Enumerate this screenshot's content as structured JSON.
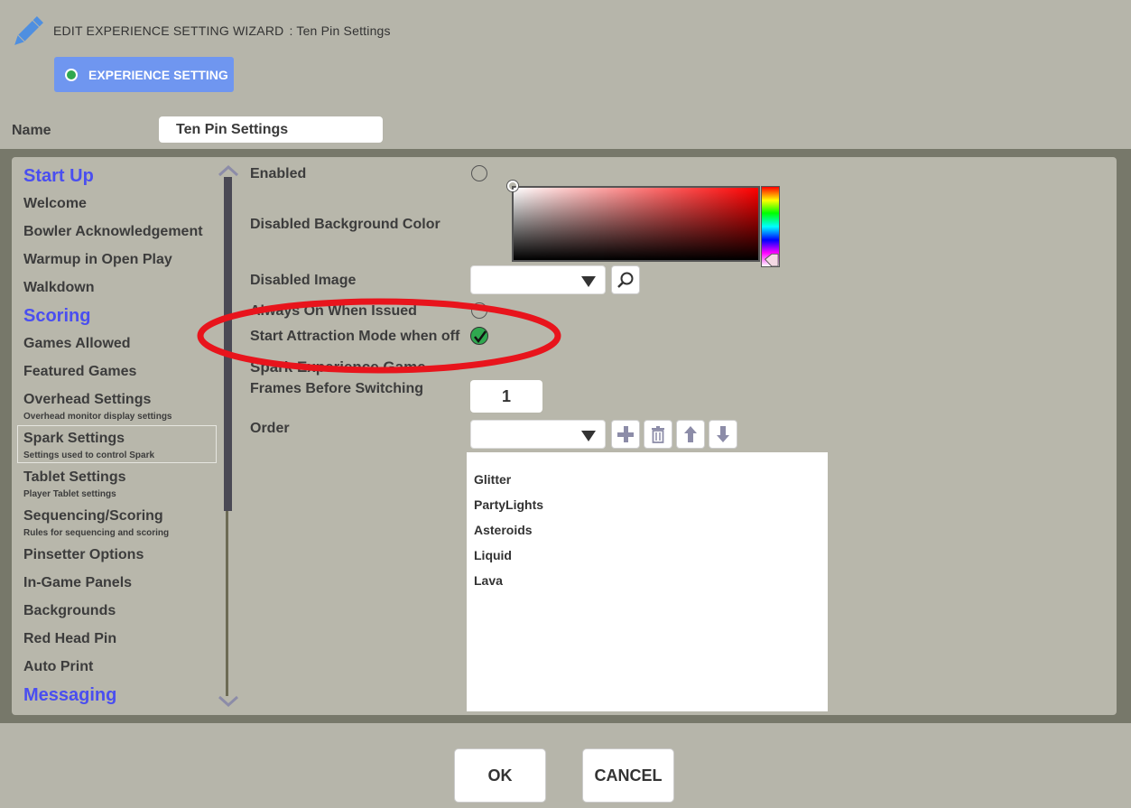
{
  "header": {
    "title": "EDIT EXPERIENCE SETTING WIZARD",
    "subtitle": ": Ten Pin Settings"
  },
  "tabs": [
    {
      "label": "EXPERIENCE SETTING"
    }
  ],
  "name": {
    "label": "Name",
    "value": "Ten Pin Settings"
  },
  "sidebar": {
    "items": [
      {
        "type": "head",
        "label": "Start Up"
      },
      {
        "type": "item",
        "label": "Welcome"
      },
      {
        "type": "item",
        "label": "Bowler Acknowledgement"
      },
      {
        "type": "item",
        "label": "Warmup in Open Play"
      },
      {
        "type": "item",
        "label": "Walkdown"
      },
      {
        "type": "head",
        "label": "Scoring"
      },
      {
        "type": "item",
        "label": "Games Allowed"
      },
      {
        "type": "item",
        "label": "Featured Games"
      },
      {
        "type": "item",
        "label": "Overhead Settings",
        "sub": "Overhead monitor display settings"
      },
      {
        "type": "item",
        "label": "Spark Settings",
        "sub": "Settings used to control Spark",
        "selected": true
      },
      {
        "type": "item",
        "label": "Tablet Settings",
        "sub": "Player Tablet settings"
      },
      {
        "type": "item",
        "label": "Sequencing/Scoring",
        "sub": "Rules for sequencing and scoring"
      },
      {
        "type": "item",
        "label": "Pinsetter Options"
      },
      {
        "type": "item",
        "label": "In-Game Panels"
      },
      {
        "type": "item",
        "label": "Backgrounds"
      },
      {
        "type": "item",
        "label": "Red Head Pin"
      },
      {
        "type": "item",
        "label": "Auto Print"
      },
      {
        "type": "head",
        "label": "Messaging"
      }
    ]
  },
  "form": {
    "enabled_label": "Enabled",
    "enabled_value": false,
    "disabled_bg_label": "Disabled Background Color",
    "disabled_image_label": "Disabled Image",
    "disabled_image_value": "",
    "always_on_label": "Always On When Issued",
    "always_on_value": false,
    "attraction_label": "Start Attraction Mode when off",
    "attraction_value": true,
    "section_label": "Spark Experience Game",
    "frames_label": "Frames Before Switching",
    "frames_value": "1",
    "order_label": "Order",
    "order_items": [
      "Glitter",
      "PartyLights",
      "Asteroids",
      "Liquid",
      "Lava"
    ]
  },
  "buttons": {
    "ok": "OK",
    "cancel": "CANCEL"
  },
  "colors": {
    "accent_blue": "#4a4ef0",
    "tab_blue": "#6f96f0",
    "check_green": "#2fa84f",
    "annotation_red": "#e8141c"
  },
  "icons": {
    "header": "pencil-icon",
    "search": "magnifier-icon",
    "add": "plus-icon",
    "delete": "trash-icon",
    "up": "arrow-up-icon",
    "down": "arrow-down-icon"
  }
}
